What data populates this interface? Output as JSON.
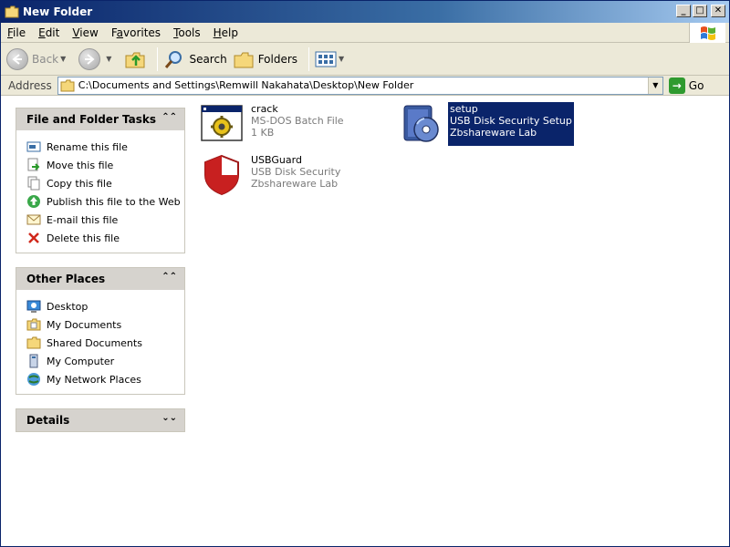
{
  "window": {
    "title": "New Folder",
    "controls": {
      "minimize": "_",
      "maximize": "□",
      "close": "✕"
    }
  },
  "menu": [
    {
      "label": "File",
      "accel": "F",
      "rest": "ile"
    },
    {
      "label": "Edit",
      "accel": "E",
      "rest": "dit"
    },
    {
      "label": "View",
      "accel": "V",
      "rest": "iew"
    },
    {
      "label": "Favorites",
      "accel": "a",
      "pre": "F",
      "rest": "vorites"
    },
    {
      "label": "Tools",
      "accel": "T",
      "rest": "ools"
    },
    {
      "label": "Help",
      "accel": "H",
      "rest": "elp"
    }
  ],
  "toolbar": {
    "back": "Back",
    "search": "Search",
    "folders": "Folders"
  },
  "address": {
    "label": "Address",
    "value": "C:\\Documents and Settings\\Remwill Nakahata\\Desktop\\New Folder",
    "go": "Go"
  },
  "tasks": {
    "title": "File and Folder Tasks",
    "items": [
      {
        "label": "Rename this file",
        "icon": "rename-icon"
      },
      {
        "label": "Move this file",
        "icon": "move-icon"
      },
      {
        "label": "Copy this file",
        "icon": "copy-icon"
      },
      {
        "label": "Publish this file to the Web",
        "icon": "publish-web-icon"
      },
      {
        "label": "E-mail this file",
        "icon": "email-icon"
      },
      {
        "label": "Delete this file",
        "icon": "delete-icon"
      }
    ]
  },
  "places": {
    "title": "Other Places",
    "items": [
      {
        "label": "Desktop",
        "icon": "desktop-icon"
      },
      {
        "label": "My Documents",
        "icon": "my-documents-icon"
      },
      {
        "label": "Shared Documents",
        "icon": "shared-documents-icon"
      },
      {
        "label": "My Computer",
        "icon": "my-computer-icon"
      },
      {
        "label": "My Network Places",
        "icon": "network-places-icon"
      }
    ]
  },
  "details": {
    "title": "Details"
  },
  "files": [
    {
      "name": "crack",
      "line2": "MS-DOS Batch File",
      "line3": "1 KB",
      "icon": "batch-file-icon",
      "selected": false
    },
    {
      "name": "setup",
      "line2": "USB Disk Security Setup",
      "line3": "Zbshareware Lab",
      "icon": "setup-installer-icon",
      "selected": true
    },
    {
      "name": "USBGuard",
      "line2": "USB Disk Security",
      "line3": "Zbshareware Lab",
      "icon": "shield-icon",
      "selected": false
    }
  ]
}
